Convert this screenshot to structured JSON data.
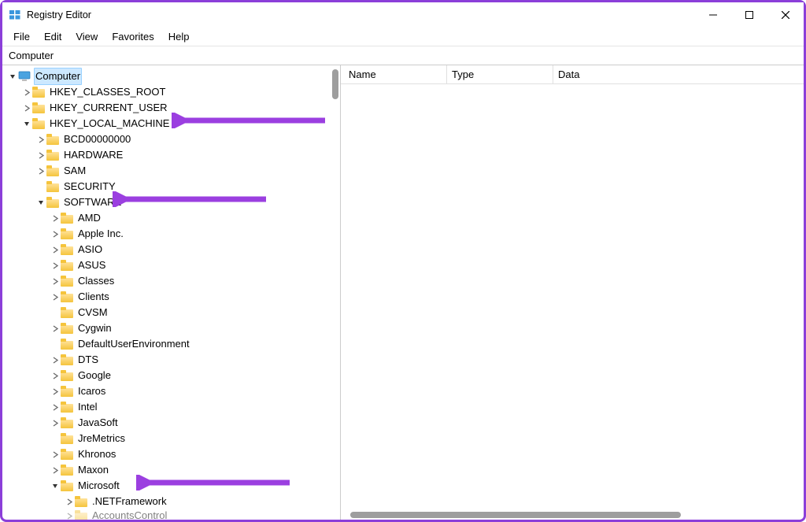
{
  "window": {
    "title": "Registry Editor"
  },
  "menu": {
    "file": "File",
    "edit": "Edit",
    "view": "View",
    "favorites": "Favorites",
    "help": "Help"
  },
  "address": "Computer",
  "columns": {
    "name": "Name",
    "type": "Type",
    "data": "Data"
  },
  "tree": {
    "root": "Computer",
    "hkcr": "HKEY_CLASSES_ROOT",
    "hkcu": "HKEY_CURRENT_USER",
    "hklm": "HKEY_LOCAL_MACHINE",
    "hklm_children": {
      "bcd": "BCD00000000",
      "hardware": "HARDWARE",
      "sam": "SAM",
      "security": "SECURITY",
      "software": "SOFTWARE"
    },
    "software_children": {
      "amd": "AMD",
      "apple": "Apple Inc.",
      "asio": "ASIO",
      "asus": "ASUS",
      "classes": "Classes",
      "clients": "Clients",
      "cvsm": "CVSM",
      "cygwin": "Cygwin",
      "due": "DefaultUserEnvironment",
      "dts": "DTS",
      "google": "Google",
      "icaros": "Icaros",
      "intel": "Intel",
      "javasoft": "JavaSoft",
      "jremetrics": "JreMetrics",
      "khronos": "Khronos",
      "maxon": "Maxon",
      "microsoft": "Microsoft"
    },
    "microsoft_children": {
      "netframework": ".NETFramework",
      "accountscontrol": "AccountsControl"
    }
  }
}
